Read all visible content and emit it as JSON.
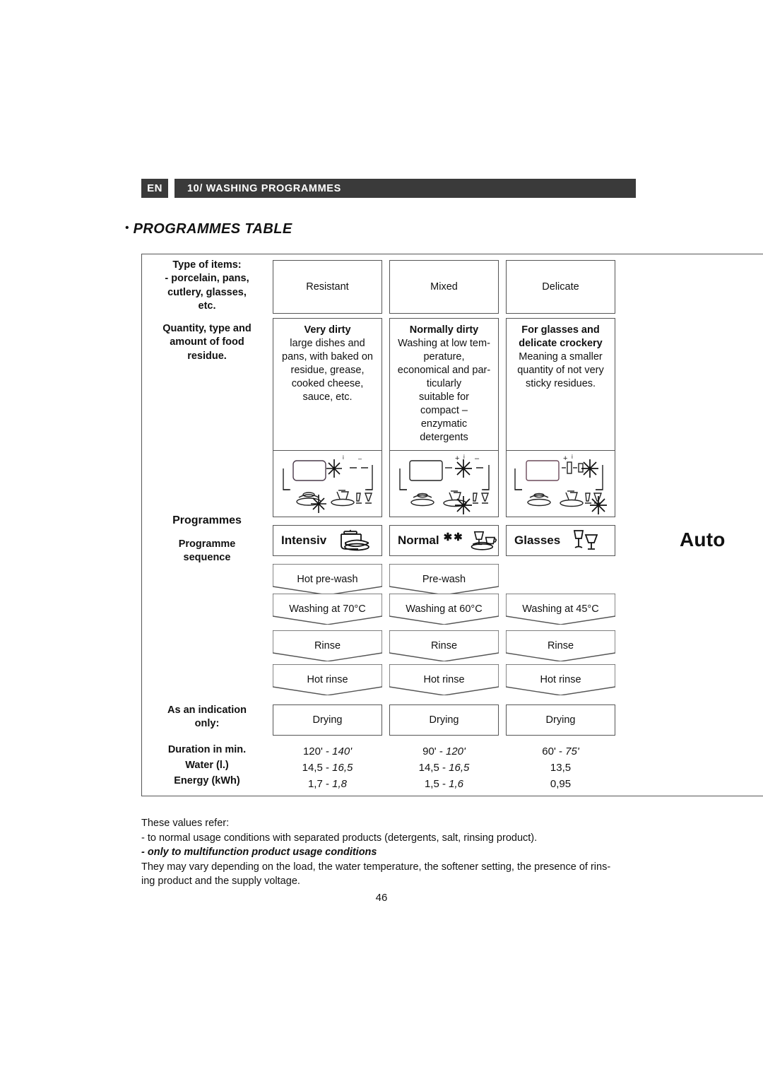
{
  "header": {
    "language": "EN",
    "chapter": "10/ WASHING PROGRAMMES"
  },
  "section": {
    "bullet": "•",
    "title": "PROGRAMMES TABLE"
  },
  "row_labels": {
    "type_of_items": "Type of items:\n- porcelain, pans,\ncutlery, glasses,\netc.",
    "quantity": "Quantity, type and\namount of food\nresidue.",
    "programmes": "Programmes",
    "programme_sequence": "Programme\nsequence",
    "indication_only": "As an indication\nonly:",
    "duration": "Duration in min.",
    "water": "Water (l.)",
    "energy": "Energy (kWh)"
  },
  "columns": [
    {
      "head": "Resistant",
      "desc_title": "Very dirty",
      "desc_body": "large dishes and\npans, with baked on\nresidue, grease,\ncooked cheese,\nsauce, etc.",
      "icon_name": "load-diagram-intensive",
      "programme": "Intensiv",
      "stars": "",
      "programme_icon": "pot-and-dish-icon",
      "steps": [
        "Hot pre-wash",
        "Washing at 70°C",
        "Rinse",
        "Hot rinse",
        "Drying"
      ],
      "duration": "120' - 140'",
      "duration_plain": "120' - ",
      "duration_italic": "140'",
      "water_plain": "14,5 - ",
      "water_italic": "16,5",
      "energy_plain": "1,7 - ",
      "energy_italic": "1,8"
    },
    {
      "head": "Mixed",
      "desc_title": "Normally dirty",
      "desc_body": "Washing at low tem-\nperature,\neconomical and par-\nticularly\nsuitable for\ncompact –\nenzymatic\ndetergents",
      "icon_name": "load-diagram-normal",
      "programme": "Normal",
      "stars": "✱✱",
      "programme_icon": "glass-cup-plate-icon",
      "steps": [
        "Pre-wash",
        "Washing at 60°C",
        "Rinse",
        "Hot rinse",
        "Drying"
      ],
      "duration": "90' - 120'",
      "duration_plain": "90' - ",
      "duration_italic": "120'",
      "water_plain": "14,5 - ",
      "water_italic": "16,5",
      "energy_plain": "1,5 - ",
      "energy_italic": "1,6"
    },
    {
      "head": "Delicate",
      "desc_title": "For glasses and\ndelicate crockery",
      "desc_body": "Meaning a smaller\nquantity of not very\nsticky residues.",
      "icon_name": "load-diagram-glasses",
      "programme": "Glasses",
      "stars": "",
      "programme_icon": "two-glasses-icon",
      "steps": [
        "",
        "Washing at 45°C",
        "Rinse",
        "Hot rinse",
        "Drying"
      ],
      "duration": "60' - 75'",
      "duration_plain": "60' - ",
      "duration_italic": "75'",
      "water_plain": "13,5",
      "water_italic": "",
      "energy_plain": "0,95",
      "energy_italic": ""
    }
  ],
  "side_word": "Auto",
  "notes": {
    "line1": "These values refer:",
    "line2": "- to normal usage conditions with separated products (detergents, salt, rinsing product).",
    "line3": "- only to multifunction product usage conditions",
    "line4": "They may vary depending on the load, the water temperature, the softener setting, the presence of rins-",
    "line5": "ing product and the supply voltage."
  },
  "page_number": "46"
}
